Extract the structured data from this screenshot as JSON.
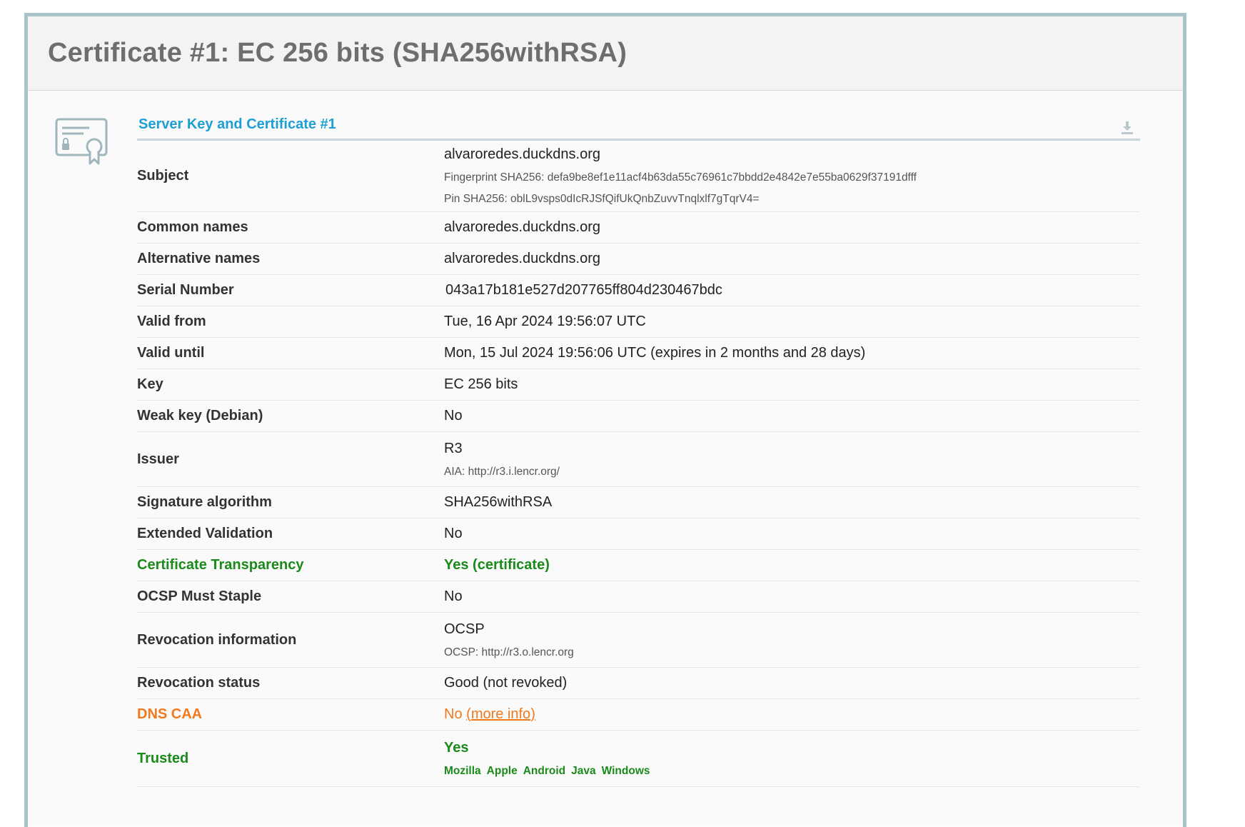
{
  "page_title": "Certificate #1: EC 256 bits (SHA256withRSA)",
  "section": {
    "title": "Server Key and Certificate #1",
    "icon": "certificate-icon",
    "download_icon": "download-icon"
  },
  "rows": {
    "subject": {
      "label": "Subject",
      "value": "alvaroredes.duckdns.org",
      "fingerprint": "Fingerprint SHA256: defa9be8ef1e11acf4b63da55c76961c7bbdd2e4842e7e55ba0629f37191dfff",
      "pin": "Pin SHA256: oblL9vsps0dIcRJSfQifUkQnbZuvvTnqlxlf7gTqrV4="
    },
    "common_names": {
      "label": "Common names",
      "value": "alvaroredes.duckdns.org"
    },
    "alternative_names": {
      "label": "Alternative names",
      "value": "alvaroredes.duckdns.org"
    },
    "serial_number": {
      "label": "Serial Number",
      "value": "043a17b181e527d207765ff804d230467bdc"
    },
    "valid_from": {
      "label": "Valid from",
      "value": "Tue, 16 Apr 2024 19:56:07 UTC"
    },
    "valid_until": {
      "label": "Valid until",
      "value": "Mon, 15 Jul 2024 19:56:06 UTC (expires in 2 months and 28 days)"
    },
    "key": {
      "label": "Key",
      "value": "EC 256 bits"
    },
    "weak_key": {
      "label": "Weak key (Debian)",
      "value": "No"
    },
    "issuer": {
      "label": "Issuer",
      "value": "R3",
      "aia": "AIA: http://r3.i.lencr.org/"
    },
    "signature_algorithm": {
      "label": "Signature algorithm",
      "value": "SHA256withRSA"
    },
    "extended_validation": {
      "label": "Extended Validation",
      "value": "No"
    },
    "certificate_transparency": {
      "label": "Certificate Transparency",
      "value": "Yes (certificate)"
    },
    "ocsp_must_staple": {
      "label": "OCSP Must Staple",
      "value": "No"
    },
    "revocation_information": {
      "label": "Revocation information",
      "value": "OCSP",
      "ocsp": "OCSP: http://r3.o.lencr.org"
    },
    "revocation_status": {
      "label": "Revocation status",
      "value": "Good (not revoked)"
    },
    "dns_caa": {
      "label": "DNS CAA",
      "value": "No",
      "link_open": "(",
      "link": "more info",
      "link_close": ")"
    },
    "trusted": {
      "label": "Trusted",
      "value": "Yes",
      "platforms": [
        "Mozilla",
        "Apple",
        "Android",
        "Java",
        "Windows"
      ]
    }
  },
  "colors": {
    "accent_blue": "#1e9fd4",
    "good_green": "#1a8a1a",
    "warn_orange": "#f17a1e",
    "frame_border": "#a9c3c9"
  }
}
